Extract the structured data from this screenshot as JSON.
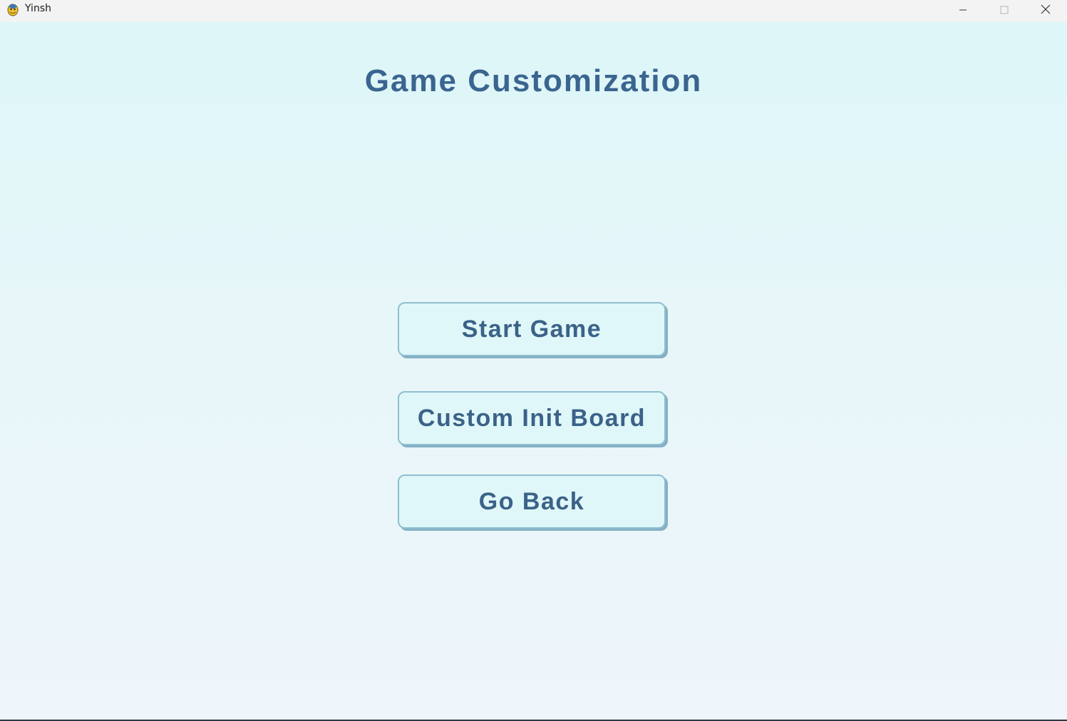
{
  "window": {
    "title": "Yinsh",
    "app_icon": "pygame-snake-icon",
    "controls": {
      "minimize_icon": "minimize-icon",
      "maximize_icon": "maximize-icon",
      "close_icon": "close-icon"
    }
  },
  "page": {
    "title": "Game Customization"
  },
  "menu": {
    "start_game_label": "Start Game",
    "custom_init_board_label": "Custom Init Board",
    "go_back_label": "Go Back"
  },
  "colors": {
    "title_text": "#3a6590",
    "button_fill": "#dff7f8",
    "button_border": "#8fbfd0",
    "button_shadow": "#85afc4",
    "background_top": "#ddf6f8",
    "background_bottom": "#eef5fb"
  }
}
